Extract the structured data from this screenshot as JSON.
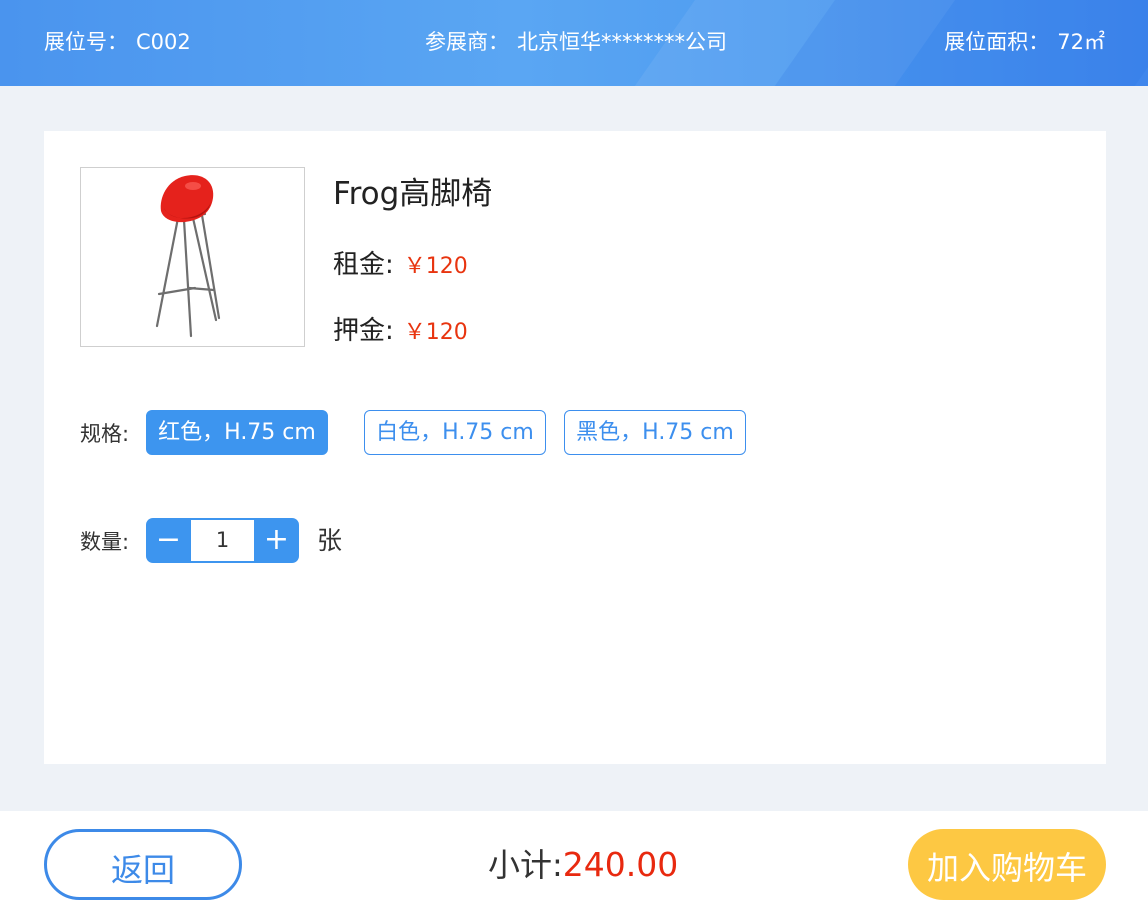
{
  "header": {
    "booth_label": "展位号：",
    "booth_value": "C002",
    "exhibitor_label": "参展商：",
    "exhibitor_value": "北京恒华********公司",
    "area_label": "展位面积：",
    "area_value": "72㎡"
  },
  "product": {
    "name": "Frog高脚椅",
    "image_icon": "red-bar-stool-image",
    "rent_label": "租金:",
    "rent_value": "￥120",
    "deposit_label": "押金:",
    "deposit_value": "￥120"
  },
  "spec": {
    "label": "规格:",
    "options": [
      {
        "label": "红色，H.75 cm",
        "selected": true
      },
      {
        "label": "白色，H.75 cm",
        "selected": false
      },
      {
        "label": "黑色，H.75 cm",
        "selected": false
      }
    ]
  },
  "quantity": {
    "label": "数量:",
    "minus": "−",
    "value": "1",
    "plus": "+",
    "unit": "张"
  },
  "footer": {
    "back_label": "返回",
    "subtotal_label": "小计:",
    "subtotal_value": "240.00",
    "add_to_cart_label": "加入购物车"
  },
  "colors": {
    "primary": "#3d95ef",
    "price": "#e8340f",
    "cart_button": "#fdc843"
  }
}
